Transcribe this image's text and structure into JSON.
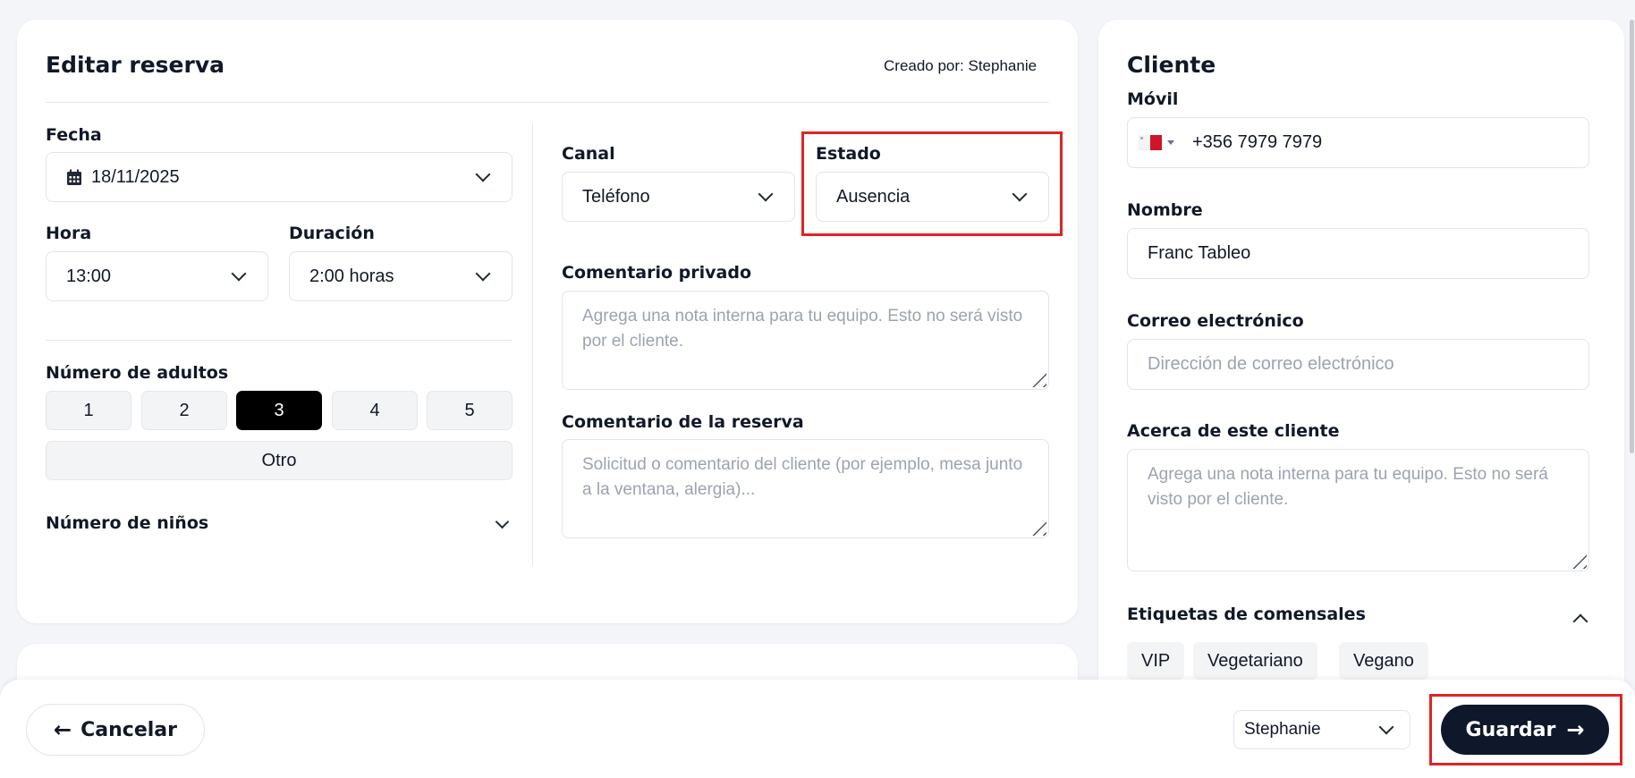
{
  "reservation": {
    "title": "Editar reserva",
    "created_by": "Creado por: Stephanie",
    "fecha_label": "Fecha",
    "fecha_value": "18/11/2025",
    "hora_label": "Hora",
    "hora_value": "13:00",
    "duracion_label": "Duración",
    "duracion_value": "2:00 horas",
    "adultos_label": "Número de adultos",
    "adultos_options": [
      "1",
      "2",
      "3",
      "4",
      "5"
    ],
    "adultos_selected": "3",
    "otro_label": "Otro",
    "ninos_label": "Número de niños",
    "canal_label": "Canal",
    "canal_value": "Teléfono",
    "estado_label": "Estado",
    "estado_value": "Ausencia",
    "comentario_privado_label": "Comentario privado",
    "comentario_privado_placeholder": "Agrega una nota interna para tu equipo. Esto no será visto por el cliente.",
    "comentario_reserva_label": "Comentario de la reserva",
    "comentario_reserva_placeholder": "Solicitud o comentario del cliente (por ejemplo, mesa junto a la ventana, alergia)..."
  },
  "client": {
    "title": "Cliente",
    "movil_label": "Móvil",
    "country_flag": "malta-flag",
    "phone_value": "+356 7979 7979",
    "nombre_label": "Nombre",
    "nombre_value": "Franc Tableo",
    "correo_label": "Correo electrónico",
    "correo_placeholder": "Dirección de correo electrónico",
    "acerca_label": "Acerca de este cliente",
    "acerca_placeholder": "Agrega una nota interna para tu equipo. Esto no será visto por el cliente.",
    "etiquetas_label": "Etiquetas de comensales",
    "tags": [
      "VIP",
      "Vegetariano",
      "Vegano"
    ]
  },
  "footer": {
    "cancel_label": "Cancelar",
    "staff_value": "Stephanie",
    "save_label": "Guardar"
  },
  "colors": {
    "highlight": "#e02424",
    "save_bg": "#0f172a",
    "selected_adult": "#000000"
  }
}
